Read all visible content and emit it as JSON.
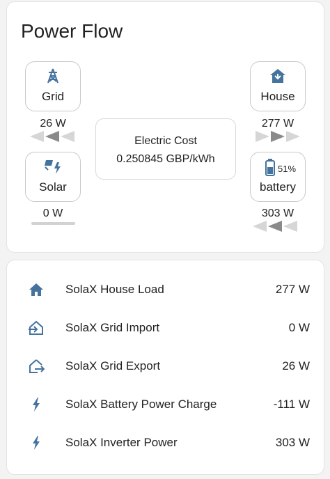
{
  "power_flow": {
    "title": "Power Flow",
    "grid": {
      "label": "Grid",
      "value": "26 W",
      "icon": "transmission-tower-icon"
    },
    "house": {
      "label": "House",
      "value": "277 W",
      "icon": "home-lightning-icon"
    },
    "solar": {
      "label": "Solar",
      "value": "0 W",
      "icon": "solar-power-icon"
    },
    "battery": {
      "label": "battery",
      "value": "303 W",
      "percent": "51%",
      "icon": "battery-icon"
    },
    "cost": {
      "label": "Electric Cost",
      "value": "0.250845 GBP/kWh"
    }
  },
  "entities": [
    {
      "name": "SolaX House Load",
      "value": "277 W",
      "icon": "home-icon"
    },
    {
      "name": "SolaX Grid Import",
      "value": "0 W",
      "icon": "home-import-icon"
    },
    {
      "name": "SolaX Grid Export",
      "value": "26 W",
      "icon": "home-export-icon"
    },
    {
      "name": "SolaX Battery Power Charge",
      "value": "-111 W",
      "icon": "lightning-bolt-icon"
    },
    {
      "name": "SolaX Inverter Power",
      "value": "303 W",
      "icon": "lightning-bolt-icon"
    }
  ],
  "colors": {
    "icon": "#44739e",
    "arrow_active": "#8a8a8a",
    "arrow_inactive": "#d6d6d6"
  }
}
